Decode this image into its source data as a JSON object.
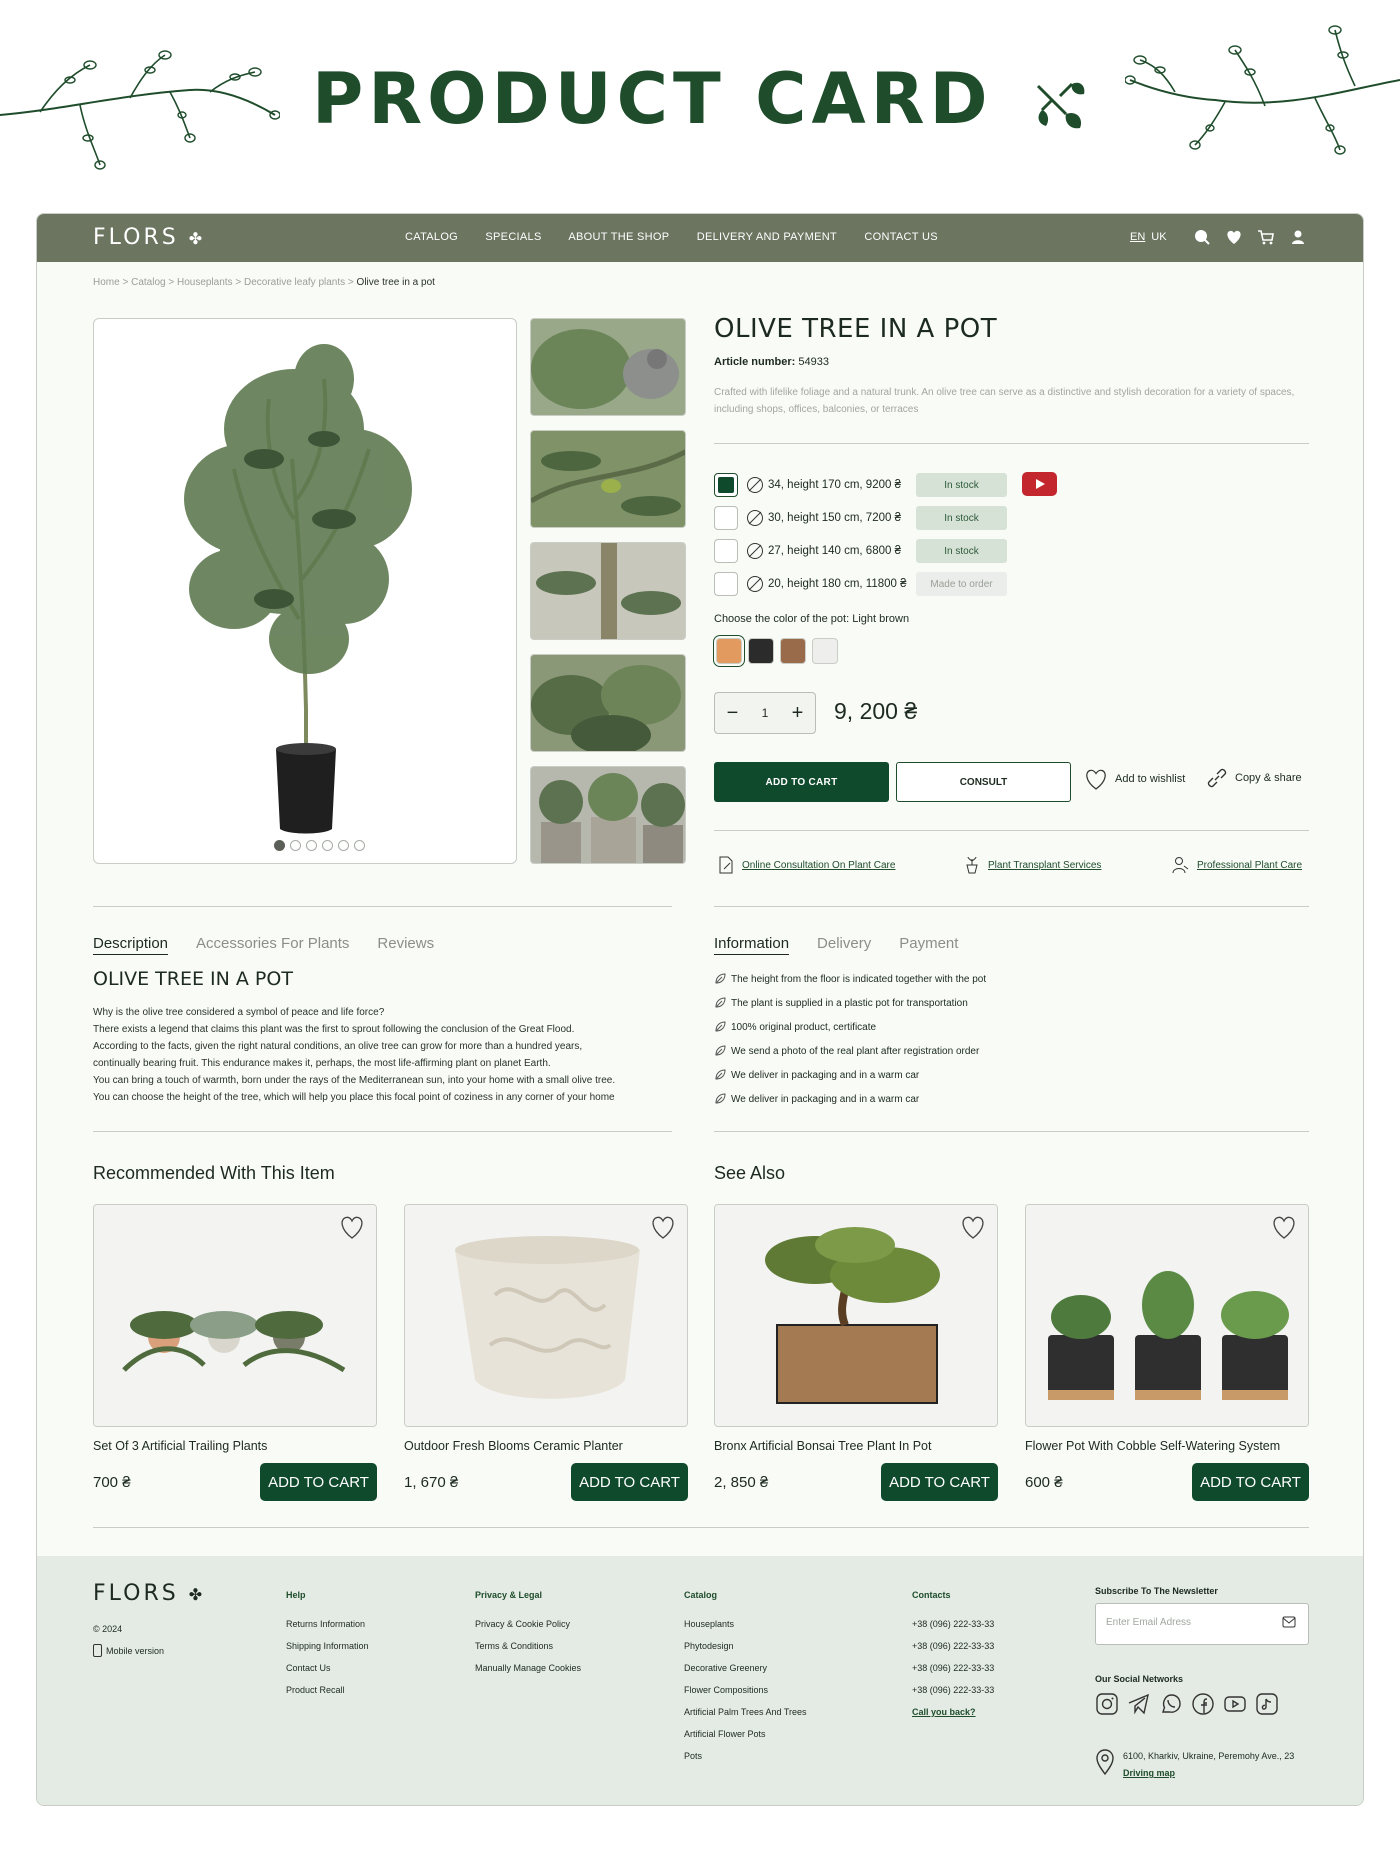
{
  "hero": {
    "title": "PRODUCT CARD"
  },
  "nav": {
    "logo": "FLORS",
    "menu": [
      "CATALOG",
      "SPECIALS",
      "ABOUT THE SHOP",
      "DELIVERY AND PAYMENT",
      "CONTACT US"
    ],
    "lang_active": "EN",
    "lang_other": "UK",
    "icons": [
      "search-icon",
      "heart-icon",
      "cart-icon",
      "user-icon"
    ]
  },
  "breadcrumb": {
    "items": [
      "Home",
      "Catalog",
      "Houseplants",
      "Decorative leafy plants"
    ],
    "separator": " > ",
    "current": "Olive tree in a pot"
  },
  "gallery": {
    "thumb_count": 5,
    "dot_count": 6,
    "active_dot": 0
  },
  "product": {
    "title": "OLIVE TREE IN A POT",
    "article_label": "Article number:",
    "article_number": "54933",
    "description": "Crafted with lifelike foliage and a natural trunk. An olive tree can serve as a distinctive and stylish decoration for a variety of spaces, including shops, offices, balconies, or terraces",
    "options": [
      {
        "label": "34, height 170 cm, 9200 ₴",
        "status": "In stock",
        "selected": true
      },
      {
        "label": "30, height 150 cm, 7200 ₴",
        "status": "In stock",
        "selected": false
      },
      {
        "label": "27, height 140 cm, 6800 ₴",
        "status": "In stock",
        "selected": false
      },
      {
        "label": "20, height 180 cm, 11800 ₴",
        "status": "Made to order",
        "selected": false
      }
    ],
    "pot_color_label": "Choose the color of the pot:",
    "pot_color_value": "Light brown",
    "pot_colors": [
      "#e39a5f",
      "#2b2b2b",
      "#9a6b4b",
      "#eeeeec"
    ],
    "quantity": "1",
    "price": "9, 200 ₴",
    "add_to_cart": "ADD TO CART",
    "consult": "CONSULT",
    "wishlist": "Add to wishlist",
    "share": "Copy & share"
  },
  "services": [
    "Online Consultation On Plant Care",
    "Plant Transplant Services",
    "Professional Plant Care"
  ],
  "desc_tabs": [
    "Description",
    "Accessories For Plants",
    "Reviews"
  ],
  "desc": {
    "title": "OLIVE TREE IN A POT",
    "lines": [
      "Why is the olive tree considered a symbol of peace and life force?",
      "There exists a legend that claims this plant was the first to sprout following the conclusion of the Great Flood.",
      "According to the facts, given the right natural conditions, an olive tree can grow for more than a hundred years,",
      "continually bearing fruit. This endurance makes it, perhaps, the most life-affirming plant on planet Earth.",
      "You can bring a touch of warmth, born under the rays of the Mediterranean sun, into your home with a small olive tree.",
      "You can choose the height of the tree, which will help you place this focal point of coziness in any corner of your home"
    ]
  },
  "info_tabs": [
    "Information",
    "Delivery",
    "Payment"
  ],
  "info_list": [
    "The height from the floor is indicated together with the pot",
    "The plant is supplied in a plastic pot for transportation",
    "100% original product, certificate",
    "We send a photo of the real plant after registration order",
    "We deliver in packaging and in a warm car",
    "We deliver in packaging and in a warm car"
  ],
  "recommended_title": "Recommended With This Item",
  "see_also_title": "See Also",
  "cards": [
    {
      "name": "Set Of 3 Artificial Trailing Plants",
      "price": "700 ₴",
      "button": "ADD TO CART"
    },
    {
      "name": "Outdoor Fresh Blooms Ceramic Planter",
      "price": "1, 670 ₴",
      "button": "ADD TO CART"
    },
    {
      "name": "Bronx Artificial Bonsai Tree Plant In Pot",
      "price": "2, 850 ₴",
      "button": "ADD TO CART"
    },
    {
      "name": "Flower Pot With Cobble Self-Watering System",
      "price": "600 ₴",
      "button": "ADD TO CART"
    }
  ],
  "footer": {
    "logo": "FLORS",
    "copyright": "© 2024",
    "mobile": "Mobile version",
    "help": {
      "title": "Help",
      "items": [
        "Returns Information",
        "Shipping Information",
        "Contact Us",
        "Product Recall"
      ]
    },
    "privacy": {
      "title": "Privacy & Legal",
      "items": [
        "Privacy & Cookie Policy",
        "Terms & Conditions",
        "Manually Manage Cookies"
      ]
    },
    "catalog": {
      "title": "Catalog",
      "items": [
        "Houseplants",
        "Phytodesign",
        "Decorative Greenery",
        "Flower Compositions",
        "Artificial Palm Trees And Trees",
        "Artificial Flower Pots",
        "Pots"
      ]
    },
    "contacts": {
      "title": "Contacts",
      "items": [
        "+38 (096) 222-33-33",
        "+38 (096) 222-33-33",
        "+38 (096) 222-33-33",
        "+38 (096) 222-33-33"
      ],
      "callback": "Call you back?"
    },
    "newsletter_title": "Subscribe To The Newsletter",
    "email_placeholder": "Enter Email Adress",
    "social_title": "Our Social Networks",
    "social_icons": [
      "instagram-icon",
      "telegram-icon",
      "whatsapp-icon",
      "facebook-icon",
      "youtube-icon",
      "tiktok-icon"
    ],
    "address": "6100, Kharkiv, Ukraine, Peremohy Ave., 23",
    "map_link": "Driving map"
  },
  "colors": {
    "brand": "#0f4a2c",
    "nav_bg": "#6b7560",
    "footer_bg": "#e4ebe4",
    "stock_bg": "#d7e2d6",
    "youtube": "#c4262d"
  }
}
